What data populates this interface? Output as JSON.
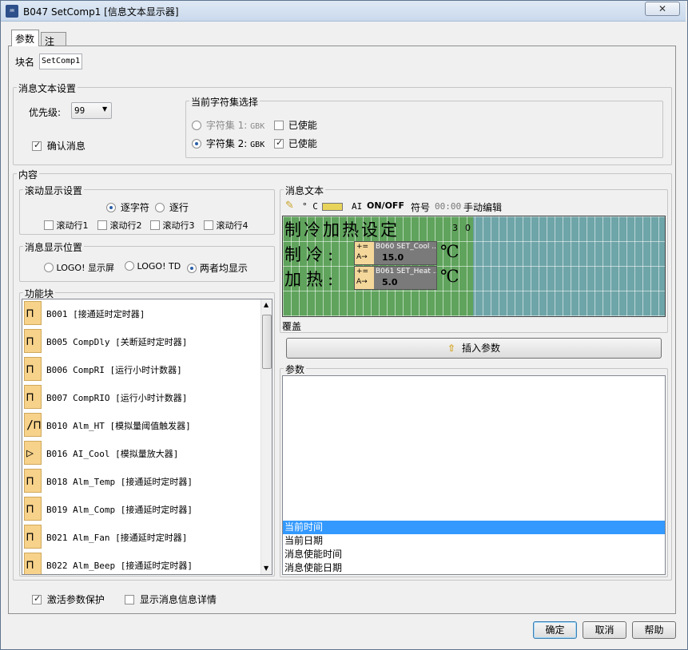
{
  "window": {
    "title": "B047 SetComp1 [信息文本显示器]",
    "close_glyph": "✕",
    "icon_text": "♒"
  },
  "tabs": [
    {
      "label": "参数"
    },
    {
      "label": "注释"
    }
  ],
  "block_name": {
    "label": "块名",
    "value": "SetComp1"
  },
  "message_settings": {
    "legend": "消息文本设置",
    "priority_label": "优先级:",
    "priority_value": "99",
    "confirm_label": "确认消息",
    "charset": {
      "legend": "当前字符集选择",
      "set1": {
        "label": "字符集 1:",
        "code": "GBK",
        "enabled_label": "已使能"
      },
      "set2": {
        "label": "字符集 2:",
        "code": "GBK",
        "enabled_label": "已使能"
      }
    }
  },
  "content": {
    "legend": "内容",
    "scroll": {
      "legend": "滚动显示设置",
      "by_char": "逐字符",
      "by_line": "逐行",
      "lines": [
        "滚动行1",
        "滚动行2",
        "滚动行3",
        "滚动行4"
      ]
    },
    "position": {
      "legend": "消息显示位置",
      "options": [
        "LOGO! 显示屏",
        "LOGO! TD",
        "两者均显示"
      ]
    },
    "function_blocks": {
      "legend": "功能块",
      "items": [
        {
          "icon": "on-delay-icon",
          "glyph": "⊓",
          "text": "B001 [接通延时定时器]"
        },
        {
          "icon": "off-delay-icon",
          "glyph": "⊓",
          "text": "B005 CompDly [关断延时定时器]"
        },
        {
          "icon": "hour-counter-icon",
          "glyph": "⊓",
          "text": "B006 CompRI [运行小时计数器]"
        },
        {
          "icon": "hour-counter-icon",
          "glyph": "⊓",
          "text": "B007 CompRIO [运行小时计数器]"
        },
        {
          "icon": "threshold-trigger-icon",
          "glyph": "∕⊓",
          "text": "B010 Alm_HT [模拟量阈值触发器]"
        },
        {
          "icon": "amplifier-icon",
          "glyph": "▷",
          "text": "B016 AI_Cool [模拟量放大器]"
        },
        {
          "icon": "on-delay-icon",
          "glyph": "⊓",
          "text": "B018 Alm_Temp [接通延时定时器]"
        },
        {
          "icon": "on-delay-icon",
          "glyph": "⊓",
          "text": "B019 Alm_Comp [接通延时定时器]"
        },
        {
          "icon": "on-delay-icon",
          "glyph": "⊓",
          "text": "B021 Alm_Fan [接通延时定时器]"
        },
        {
          "icon": "on-delay-icon",
          "glyph": "⊓",
          "text": "B022 Alm_Beep [接通延时定时器]"
        }
      ]
    },
    "message_text": {
      "legend": "消息文本",
      "toolbar": {
        "degree": "° C",
        "ai": "AI",
        "onoff": "ON/OFF",
        "symbol": "符号",
        "time": "00:00",
        "manual_edit": "手动编辑"
      },
      "lcd": {
        "row1": [
          "制",
          "冷",
          "加",
          "热",
          "设",
          "定"
        ],
        "row1_digits": [
          "3",
          "0"
        ],
        "row2": [
          "制",
          "冷",
          ":"
        ],
        "row3": [
          "加",
          "热",
          ":"
        ],
        "unit": "℃",
        "param1": {
          "tag1": "+=",
          "tag2": "A→",
          "name": "B060 SET_Cool ...",
          "value": "15.0"
        },
        "param2": {
          "tag1": "+=",
          "tag2": "A→",
          "name": "B061 SET_Heat ...",
          "value": "5.0"
        }
      },
      "overwrite_label": "覆盖"
    },
    "insert_param_button": "插入参数",
    "params": {
      "legend": "参数",
      "items": [
        "当前时间",
        "当前日期",
        "消息使能时间",
        "消息使能日期"
      ],
      "selected_index": 0
    }
  },
  "footer": {
    "protect_label": "激活参数保护",
    "details_label": "显示消息信息详情"
  },
  "buttons": {
    "ok": "确定",
    "cancel": "取消",
    "help": "帮助"
  }
}
